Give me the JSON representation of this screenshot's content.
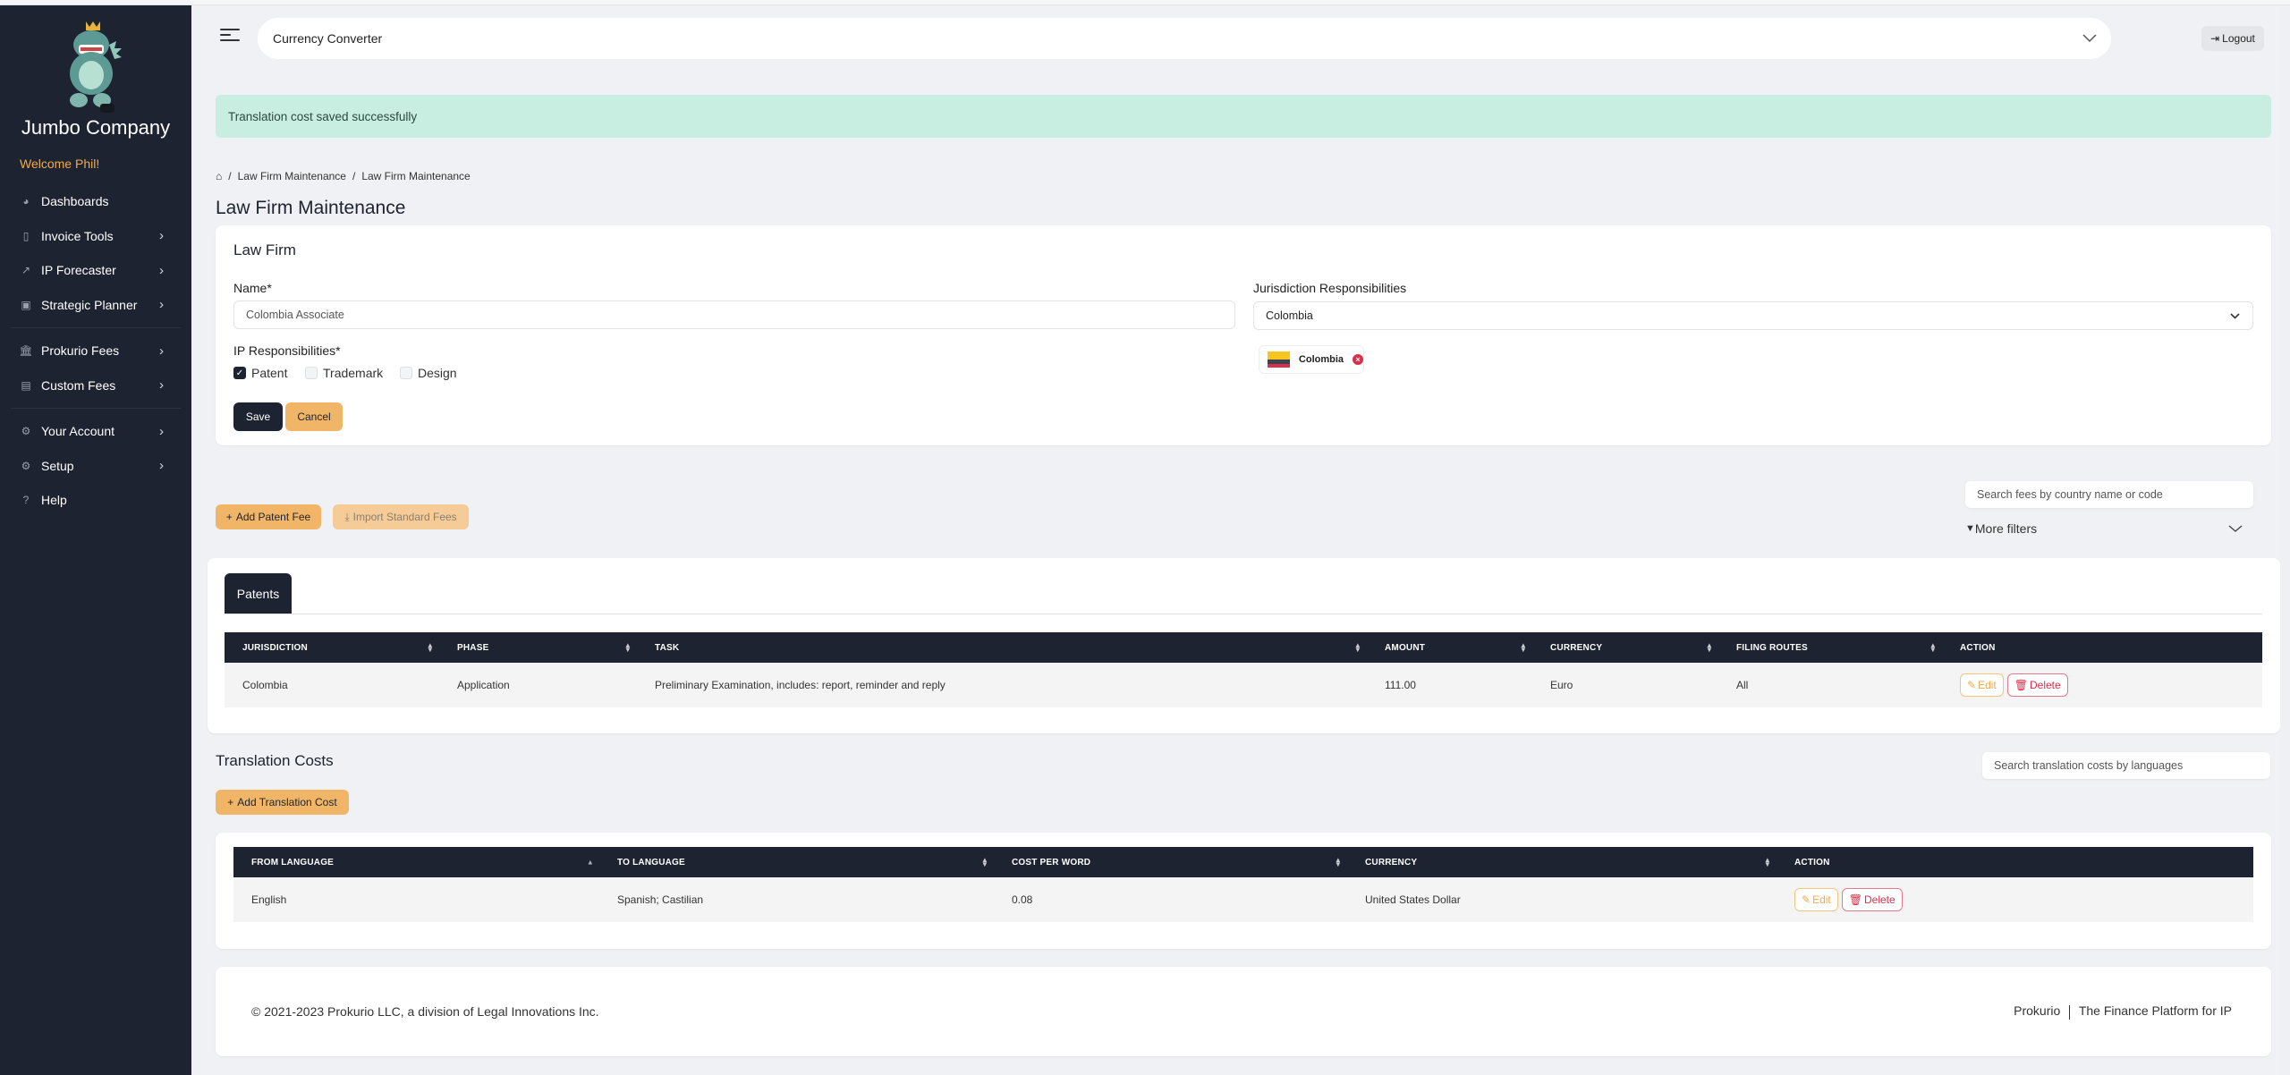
{
  "app": {
    "company": "Jumbo Company",
    "welcome": "Welcome Phil!"
  },
  "sidebar": {
    "items": [
      {
        "label": "Dashboards",
        "icon": "pie-chart-icon",
        "chevron": false
      },
      {
        "label": "Invoice Tools",
        "icon": "invoice-icon",
        "chevron": true
      },
      {
        "label": "IP Forecaster",
        "icon": "line-chart-icon",
        "chevron": true
      },
      {
        "label": "Strategic Planner",
        "icon": "planner-icon",
        "chevron": true
      },
      {
        "label": "Prokurio Fees",
        "icon": "bank-icon",
        "chevron": true
      },
      {
        "label": "Custom Fees",
        "icon": "user-card-icon",
        "chevron": true
      },
      {
        "label": "Your Account",
        "icon": "gear-icon",
        "chevron": true
      },
      {
        "label": "Setup",
        "icon": "gear-icon",
        "chevron": true
      },
      {
        "label": "Help",
        "icon": "question-icon",
        "chevron": false
      }
    ]
  },
  "header": {
    "currency_converter": "Currency Converter",
    "logout": "Logout"
  },
  "alert": {
    "message": "Translation cost saved successfully",
    "color": "#c7eee0"
  },
  "breadcrumb": [
    "Law Firm Maintenance",
    "Law Firm Maintenance"
  ],
  "page_title": "Law Firm Maintenance",
  "law_firm_form": {
    "heading": "Law Firm",
    "name_label": "Name*",
    "name_value": "Colombia Associate",
    "ip_label": "IP Responsibilities*",
    "ip_options": [
      {
        "label": "Patent",
        "checked": true
      },
      {
        "label": "Trademark",
        "checked": false
      },
      {
        "label": "Design",
        "checked": false
      }
    ],
    "jurisdiction_label": "Jurisdiction Responsibilities",
    "jurisdiction_value": "Colombia",
    "selected_chip": "Colombia",
    "save": "Save",
    "cancel": "Cancel"
  },
  "fees": {
    "add_button": "Add Patent Fee",
    "import_button": "Import Standard Fees",
    "search_placeholder": "Search fees by country name or code",
    "more_filters": "More filters",
    "tab": "Patents",
    "columns": [
      "JURISDICTION",
      "PHASE",
      "TASK",
      "AMOUNT",
      "CURRENCY",
      "FILING ROUTES",
      "ACTION"
    ],
    "rows": [
      {
        "jurisdiction": "Colombia",
        "phase": "Application",
        "task": "Preliminary Examination, includes: report, reminder and reply",
        "amount": "111.00",
        "currency": "Euro",
        "filing_routes": "All"
      }
    ]
  },
  "translation": {
    "title": "Translation Costs",
    "add_button": "Add Translation Cost",
    "search_placeholder": "Search translation costs by languages",
    "columns": [
      "FROM LANGUAGE",
      "TO LANGUAGE",
      "COST PER WORD",
      "CURRENCY",
      "ACTION"
    ],
    "rows": [
      {
        "from": "English",
        "to": "Spanish; Castilian",
        "cost": "0.08",
        "currency": "United States Dollar"
      }
    ]
  },
  "actions": {
    "edit": "Edit",
    "delete": "Delete"
  },
  "footer": {
    "copyright": "© 2021-2023 Prokurio LLC, a division of Legal Innovations Inc.",
    "tagline_brand": "Prokurio",
    "tagline_text": "The Finance Platform for IP"
  },
  "colors": {
    "sidebar_bg": "#1d2330",
    "accent_orange": "#f1b567",
    "welcome_text": "#f0a94e",
    "delete_red": "#d9304a"
  }
}
